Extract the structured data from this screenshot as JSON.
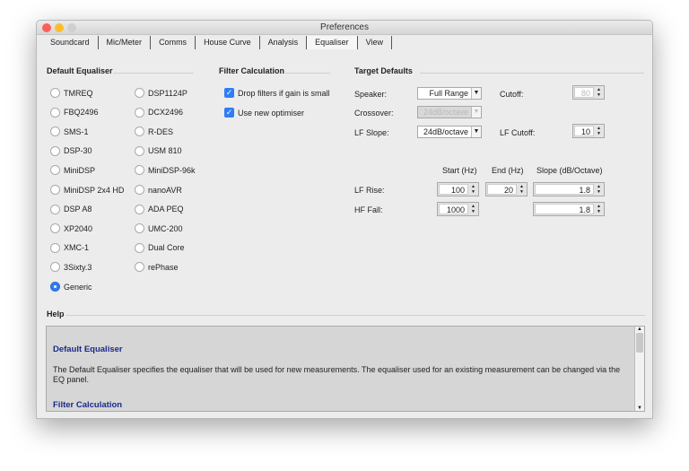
{
  "window": {
    "title": "Preferences"
  },
  "tabs": [
    "Soundcard",
    "Mic/Meter",
    "Comms",
    "House Curve",
    "Analysis",
    "Equaliser",
    "View"
  ],
  "default_equaliser": {
    "title": "Default Equaliser",
    "col1": [
      "TMREQ",
      "FBQ2496",
      "SMS-1",
      "DSP-30",
      "MiniDSP",
      "MiniDSP 2x4 HD",
      "DSP A8",
      "XP2040",
      "XMC-1",
      "3Sixty.3",
      "Generic"
    ],
    "col2": [
      "DSP1124P",
      "DCX2496",
      "R-DES",
      "USM 810",
      "MiniDSP-96k",
      "nanoAVR",
      "ADA PEQ",
      "UMC-200",
      "Dual Core",
      "rePhase"
    ],
    "selected": "Generic"
  },
  "filter_calc": {
    "title": "Filter Calculation",
    "drop_filters": "Drop filters if gain is small",
    "new_optimiser": "Use new optimiser"
  },
  "target": {
    "title": "Target Defaults",
    "speaker_label": "Speaker:",
    "speaker": "Full Range",
    "crossover_label": "Crossover:",
    "crossover": "24dB/octave",
    "lf_slope_label": "LF Slope:",
    "lf_slope": "24dB/octave",
    "cutoff_label": "Cutoff:",
    "cutoff": "80",
    "lf_cutoff_label": "LF Cutoff:",
    "lf_cutoff": "10",
    "start_hdr": "Start (Hz)",
    "end_hdr": "End (Hz)",
    "slope_hdr": "Slope (dB/Octave)",
    "lf_rise_label": "LF Rise:",
    "lf_rise_start": "100",
    "lf_rise_end": "20",
    "lf_rise_slope": "1.8",
    "hf_fall_label": "HF Fall:",
    "hf_fall_start": "1000",
    "hf_fall_slope": "1.8"
  },
  "help": {
    "title": "Help",
    "h1": "Default Equaliser",
    "p1": "The Default Equaliser specifies the equaliser that will be used for new measurements. The equaliser used for an existing measurement can be changed via the EQ panel.",
    "h2": "Filter Calculation"
  }
}
